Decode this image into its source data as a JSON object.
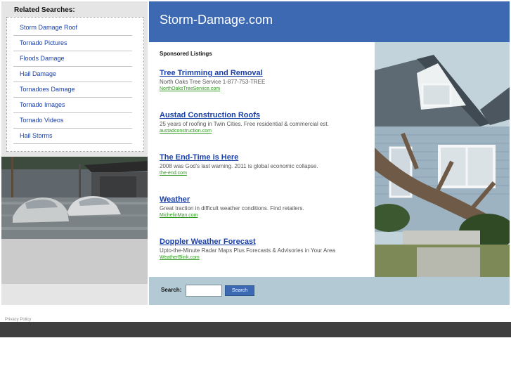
{
  "related_searches": {
    "title": "Related Searches:",
    "items": [
      "Storm Damage Roof",
      "Tornado Pictures",
      "Floods Damage",
      "Hail Damage",
      "Tornadoes Damage",
      "Tornado Images",
      "Tornado Videos",
      "Hail Storms"
    ]
  },
  "header": {
    "title": "Storm-Damage.com"
  },
  "main": {
    "sponsored_label": "Sponsored Listings",
    "listings": [
      {
        "title": "Tree Trimming and Removal",
        "description": "North Oaks Tree Service 1-877-753-TREE",
        "url": "NorthOaksTreeService.com"
      },
      {
        "title": "Austad Construction Roofs",
        "description": "25 years of roofing in Twin Cities. Free residential & commercial est.",
        "url": "austadconstruction.com"
      },
      {
        "title": "The End-Time is Here",
        "description": "2008 was God's last warning. 2011 is global economic collapse.",
        "url": "the-end.com"
      },
      {
        "title": "Weather",
        "description": "Great traction in difficult weather conditions. Find retailers.",
        "url": "MichelinMan.com"
      },
      {
        "title": "Doppler Weather Forecast",
        "description": "Upto-the-Minute Radar Maps Plus Forecasts & Advisories in Your Area",
        "url": "WeatherBlink.com"
      }
    ]
  },
  "search": {
    "label": "Search:",
    "value": "",
    "button_label": "Search"
  },
  "footer": {
    "privacy_label": "Privacy Policy"
  },
  "colors": {
    "header_blue": "#3c69b2",
    "link_blue": "#1a3fa8",
    "url_green": "#2e9a1e",
    "search_band": "#b3c9d3",
    "footer_band": "#3f3f3f"
  }
}
